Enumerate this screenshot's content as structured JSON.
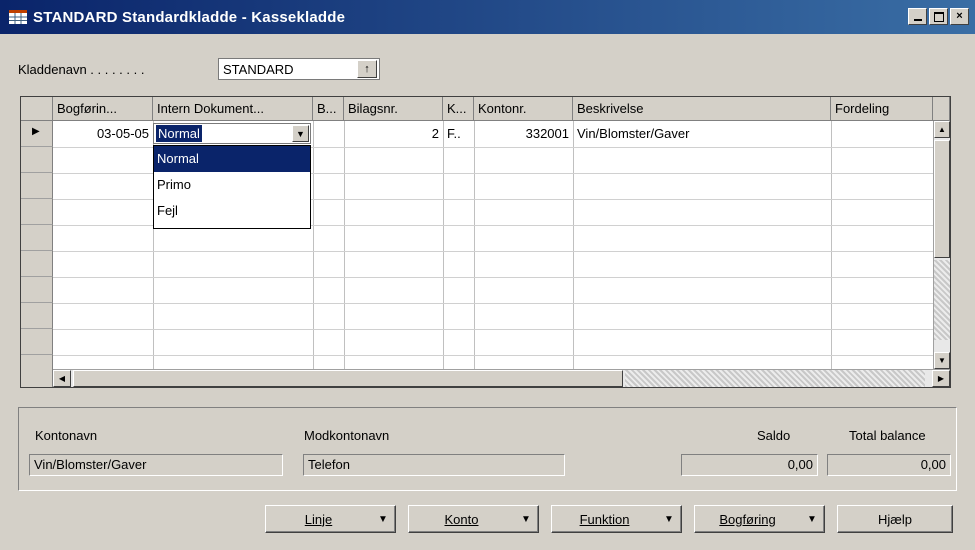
{
  "window": {
    "title": "STANDARD Standardkladde - Kassekladde",
    "min_label": "_",
    "max_label": "□",
    "close_label": "×"
  },
  "journal": {
    "label": "Kladdenavn . . . . . . . .",
    "value": "STANDARD",
    "lookup_glyph": "↑"
  },
  "grid": {
    "columns": [
      "Bogførin...",
      "Intern Dokument...",
      "B...",
      "Bilagsnr.",
      "K...",
      "Kontonr.",
      "Beskrivelse",
      "Fordeling"
    ],
    "rows": [
      {
        "posting_date": "03-05-05",
        "doc_type": "Normal",
        "document_no": "2",
        "account_type": "F..",
        "account_no": "332001",
        "description": "Vin/Blomster/Gaver"
      }
    ],
    "row_marker": "▶",
    "dropdown_options": [
      "Normal",
      "Primo",
      "Fejl"
    ]
  },
  "info": {
    "account_name_label": "Kontonavn",
    "account_name_value": "Vin/Blomster/Gaver",
    "balacc_name_label": "Modkontonavn",
    "balacc_name_value": "Telefon",
    "balance_label": "Saldo",
    "balance_value": "0,00",
    "total_balance_label": "Total balance",
    "total_balance_value": "0,00"
  },
  "buttons": {
    "line": "Linje",
    "account": "Konto",
    "functions": "Funktion",
    "posting": "Bogføring",
    "help": "Hjælp",
    "arrow": "▼"
  }
}
